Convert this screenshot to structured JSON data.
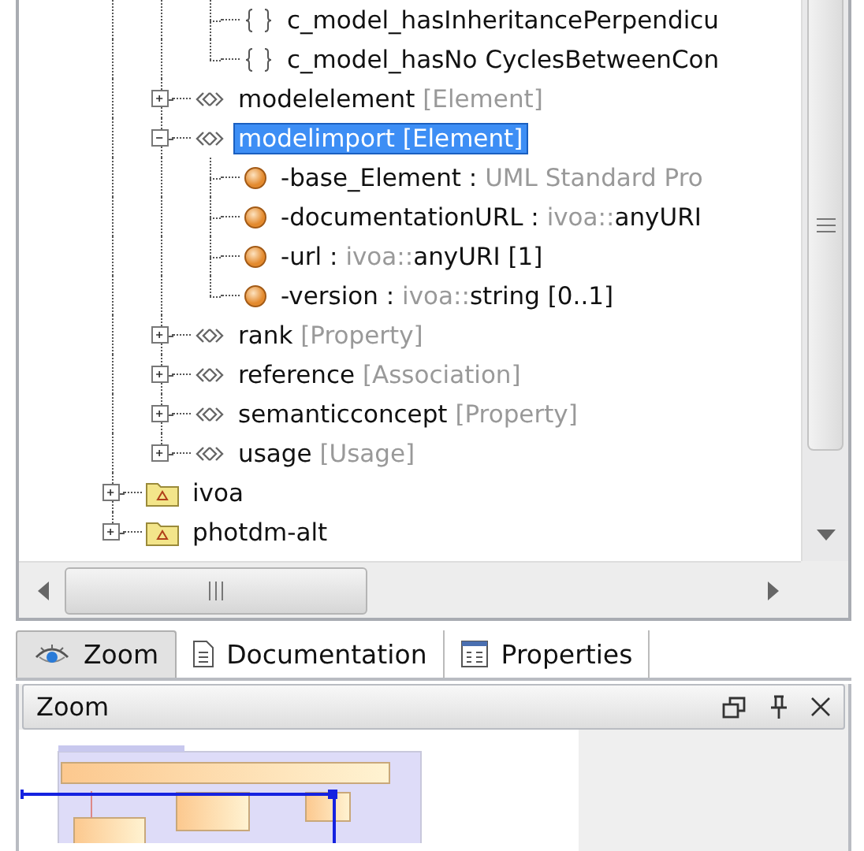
{
  "tree": {
    "items": [
      {
        "children": [
          {
            "children": [
              {
                "kind": "constraint",
                "name": "c_model_hasInheritancePerpendicu"
              },
              {
                "kind": "constraint",
                "name": "c_model_hasNo CyclesBetweenCon"
              }
            ]
          },
          {
            "kind": "stereotype",
            "name": "modelelement",
            "type": "[Element]",
            "expanded": false,
            "selected": false
          },
          {
            "kind": "stereotype",
            "name": "modelimport",
            "type": "[Element]",
            "expanded": true,
            "selected": true,
            "children": [
              {
                "kind": "attribute",
                "name": "-base_Element :",
                "namespace": "UML Standard Pro"
              },
              {
                "kind": "attribute",
                "name": "-documentationURL :",
                "namespace": "ivoa::",
                "type": "anyURI"
              },
              {
                "kind": "attribute",
                "name": "-url :",
                "namespace": "ivoa::",
                "type": "anyURI [1]"
              },
              {
                "kind": "attribute",
                "name": "-version :",
                "namespace": "ivoa::",
                "type": "string [0..1]"
              }
            ]
          },
          {
            "kind": "stereotype",
            "name": "rank",
            "type": "[Property]",
            "expanded": false,
            "selected": false
          },
          {
            "kind": "stereotype",
            "name": "reference",
            "type": "[Association]",
            "expanded": false,
            "selected": false
          },
          {
            "kind": "stereotype",
            "name": "semanticconcept",
            "type": "[Property]",
            "expanded": false,
            "selected": false
          },
          {
            "kind": "stereotype",
            "name": "usage",
            "type": "[Usage]",
            "expanded": false,
            "selected": false
          }
        ]
      },
      {
        "kind": "package",
        "name": "ivoa",
        "expanded": false,
        "selected": false
      },
      {
        "kind": "package",
        "name": "photdm-alt",
        "expanded": false,
        "selected": false
      }
    ]
  },
  "tabs": [
    {
      "label": "Zoom",
      "selected": true
    },
    {
      "label": "Documentation",
      "selected": false
    },
    {
      "label": "Properties",
      "selected": false
    }
  ],
  "panel": {
    "title": "Zoom"
  }
}
